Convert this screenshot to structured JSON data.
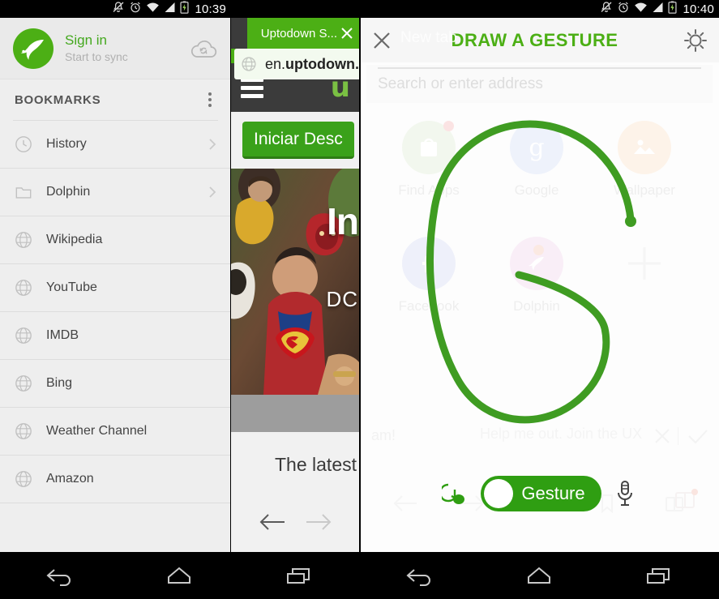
{
  "panels": {
    "left": {
      "status_bar": {
        "time": "10:39",
        "icons": [
          "bell-muted-icon",
          "alarm-clock-icon",
          "wifi-icon",
          "cellular-signal-icon",
          "battery-charging-icon"
        ]
      },
      "account": {
        "logo": "dolphin-logo",
        "title": "Sign in",
        "subtitle": "Start to sync",
        "sync_icon": "cloud-sync-icon"
      },
      "bookmarks": {
        "header": "BOOKMARKS",
        "overflow_icon": "kebab-menu-icon",
        "items": [
          {
            "label": "History",
            "icon": "clock-icon",
            "chevron": true
          },
          {
            "label": "Dolphin",
            "icon": "folder-icon",
            "chevron": true
          },
          {
            "label": "Wikipedia",
            "icon": "globe-icon",
            "chevron": false
          },
          {
            "label": "YouTube",
            "icon": "globe-icon",
            "chevron": false
          },
          {
            "label": "IMDB",
            "icon": "globe-icon",
            "chevron": false
          },
          {
            "label": "Bing",
            "icon": "globe-icon",
            "chevron": false
          },
          {
            "label": "Weather Channel",
            "icon": "globe-icon",
            "chevron": false
          },
          {
            "label": "Amazon",
            "icon": "globe-icon",
            "chevron": false
          }
        ]
      }
    },
    "middle": {
      "tab": {
        "title": "Uptodown S...",
        "close_icon": "close-icon"
      },
      "address_bar": {
        "value": "en.uptodown.c",
        "value_prefix": "en.",
        "value_bold": "uptodown.c",
        "icon": "globe-icon"
      },
      "site": {
        "menu_icon": "hamburger-menu-icon",
        "logo_text": "u"
      },
      "cta_button": "Iniciar Desc",
      "hero": {
        "title": "In",
        "subtitle": "DC",
        "alt": "injustice-banner-image"
      },
      "section_title": "The latest",
      "prev_icon": "arrow-left-icon",
      "next_icon": "arrow-right-icon"
    },
    "right": {
      "status_bar": {
        "time": "10:40",
        "icons": [
          "bell-muted-icon",
          "alarm-clock-icon",
          "wifi-icon",
          "cellular-signal-icon",
          "battery-charging-icon"
        ]
      },
      "top_bar": {
        "close_icon": "close-icon",
        "ghost_tab_label": "New tab",
        "title": "DRAW A GESTURE",
        "settings_icon": "gear-icon"
      },
      "search": {
        "placeholder": "Search or enter address"
      },
      "speed_dial": [
        {
          "label": "Find Apps",
          "icon": "shopping-bag-icon",
          "circle": "#f2f7ee",
          "badge": "#fbe3e3"
        },
        {
          "label": "Google",
          "icon": "google-g-icon",
          "circle": "#eef2fb",
          "badge": ""
        },
        {
          "label": "Wallpaper",
          "icon": "image-icon",
          "circle": "#fdf3e9",
          "badge": ""
        },
        {
          "label": "Facebook",
          "icon": "facebook-icon",
          "circle": "#eef0fa",
          "badge": ""
        },
        {
          "label": "Dolphin",
          "icon": "dolphin-icon",
          "circle": "#f9eef7",
          "badge": "#fbe9e2"
        },
        {
          "label": "",
          "icon": "plus-icon",
          "circle": "",
          "badge": ""
        }
      ],
      "gesture": {
        "drawn_letter": "G",
        "stroke_color": "#3f9c22"
      },
      "ghost_banner": {
        "left_text": "am!",
        "text": "Help me out. Join the UX",
        "dismiss_icon": "close-icon",
        "accept_icon": "check-icon"
      },
      "ghost_nav": [
        "arrow-left-icon",
        "arrow-right-icon",
        "home-icon",
        "bookmark-icon",
        "tabs-icon"
      ],
      "bottom_bar": {
        "hand_icon": "hand-gesture-icon",
        "toggle_label": "Gesture",
        "toggle_on": true,
        "mic_icon": "microphone-icon",
        "toggle_color": "#2f9e12"
      }
    }
  },
  "android_nav": {
    "items": [
      "back-icon",
      "home-icon",
      "recents-icon"
    ]
  },
  "colors": {
    "brand_green": "#4caf15",
    "toggle_green": "#2f9e12",
    "stroke_green": "#3f9c22",
    "sidebar_bg": "#eeeeee",
    "dark_bar": "#3b3b3b"
  }
}
